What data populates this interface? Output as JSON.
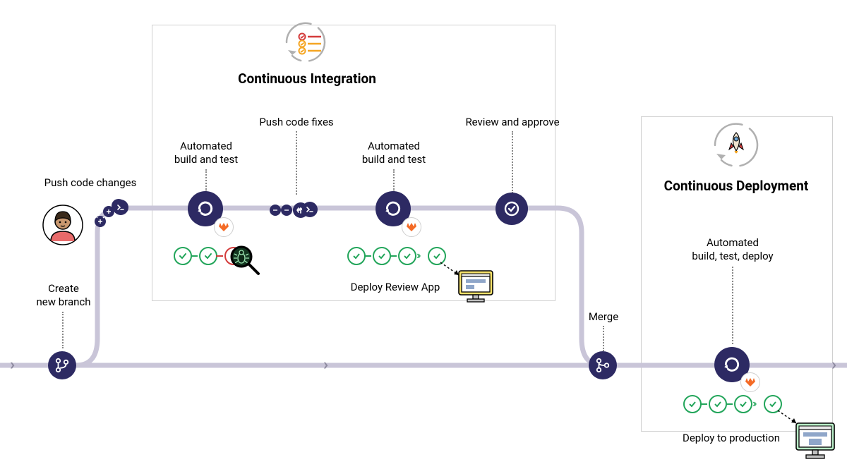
{
  "diagram": {
    "baseline": {
      "create_branch": "Create\nnew branch",
      "merge": "Merge"
    },
    "branch": {
      "push_changes": "Push code changes",
      "push_fixes": "Push code fixes",
      "review_approve": "Review and approve"
    },
    "ci": {
      "title": "Continuous Integration",
      "build_test_1": "Automated\nbuild and test",
      "build_test_2": "Automated\nbuild and test",
      "deploy_review": "Deploy Review App"
    },
    "cd": {
      "title": "Continuous Deployment",
      "build_test_deploy": "Automated\nbuild, test, deploy",
      "deploy_prod": "Deploy to production"
    }
  },
  "colors": {
    "node": "#2d2a63",
    "track": "#c9c5d8",
    "pass": "#22a55a",
    "fail": "#d43c3c",
    "box": "#d0d0d0"
  }
}
